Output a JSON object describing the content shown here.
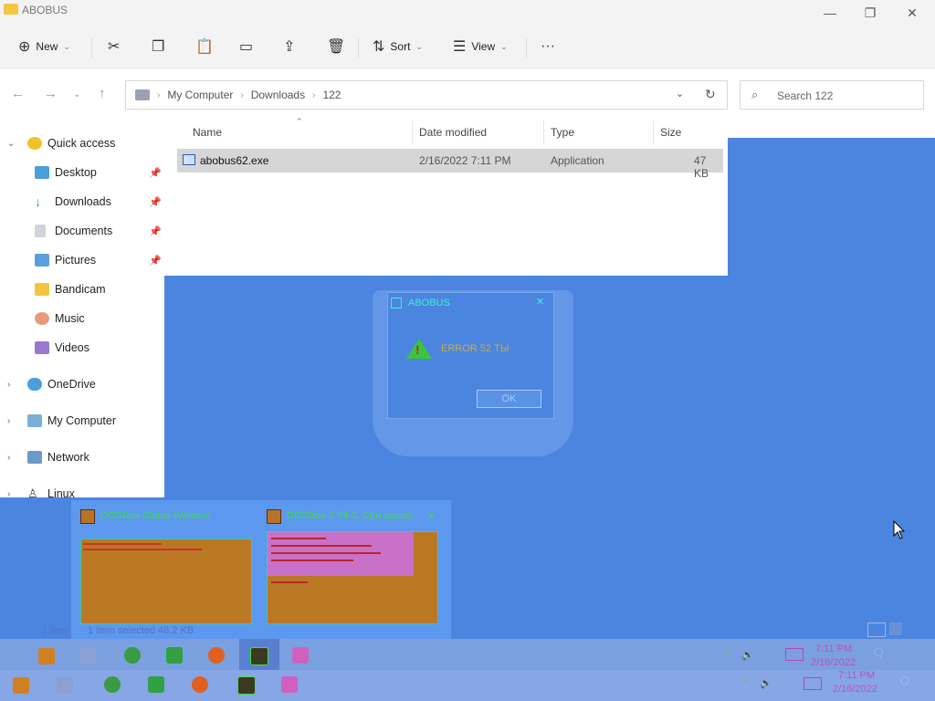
{
  "window": {
    "title": "ABOBUS",
    "minimize_glyph": "—",
    "maximize_glyph": "❐",
    "close_glyph": "✕"
  },
  "toolbar": {
    "new_label": "New",
    "sort_label": "Sort",
    "view_label": "View",
    "more_glyph": "···",
    "icons": [
      "cut-icon",
      "copy-icon",
      "paste-icon",
      "rename-icon",
      "share-icon",
      "delete-icon"
    ]
  },
  "address": {
    "crumbs": [
      "My Computer",
      "Downloads",
      "122"
    ],
    "search_placeholder": "Search 122"
  },
  "sidebar": {
    "items": [
      {
        "label": "Quick access",
        "icon": "star-icon"
      },
      {
        "label": "Desktop",
        "icon": "desktop-icon"
      },
      {
        "label": "Downloads",
        "icon": "download-icon"
      },
      {
        "label": "Documents",
        "icon": "document-icon"
      },
      {
        "label": "Pictures",
        "icon": "picture-icon"
      },
      {
        "label": "Bandicam",
        "icon": "folder-icon"
      },
      {
        "label": "Music",
        "icon": "music-icon"
      },
      {
        "label": "Videos",
        "icon": "video-icon"
      },
      {
        "label": "OneDrive",
        "icon": "cloud-icon"
      },
      {
        "label": "My Computer",
        "icon": "computer-icon"
      },
      {
        "label": "Network",
        "icon": "network-icon"
      },
      {
        "label": "Linux",
        "icon": "linux-icon"
      }
    ]
  },
  "filelist": {
    "columns": [
      "Name",
      "Date modified",
      "Type",
      "Size"
    ],
    "rows": [
      {
        "name": "abobus62.exe",
        "date": "2/16/2022 7:11 PM",
        "type": "Application",
        "size": "47 KB"
      }
    ]
  },
  "dialog": {
    "title": "ABOBUS",
    "message": "ERROR 52 ТЫ",
    "ok_label": "OK"
  },
  "previews": [
    {
      "title": "DOSBox Status Window"
    },
    {
      "title": "DOSBox 0.74-3, Cpu speed:"
    }
  ],
  "status": {
    "items_count": "1 item",
    "selected": "1 item selected  46.2 KB"
  },
  "clock": {
    "time": "7:11 PM",
    "date": "2/16/2022"
  },
  "colors": {
    "desktop": "#4b85e0",
    "selection": "#d6d6d6",
    "accent_green": "#40e040"
  }
}
